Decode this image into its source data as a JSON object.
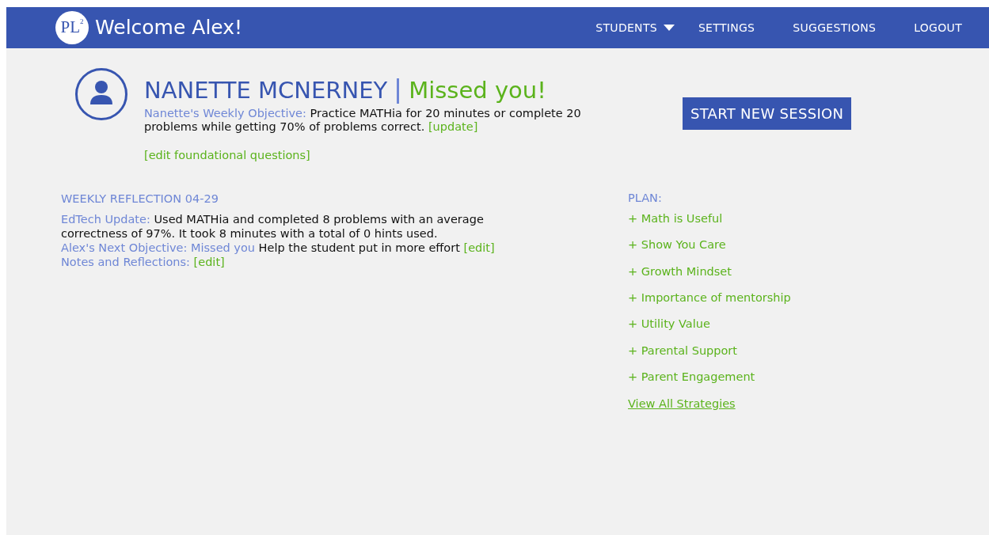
{
  "header": {
    "logo": "PL$^{2}$",
    "title": "Welcome Alex!"
  },
  "nav": [
    {
      "label": "STUDENTS",
      "kind": "dropdown"
    },
    {
      "label": "SETTINGS",
      "kind": "link"
    },
    {
      "label": "SUGGESTIONS",
      "kind": "link"
    },
    {
      "label": "LOGOUT",
      "kind": "link"
    }
  ],
  "student": {
    "name": "NANETTE MCNERNEY",
    "status": "Missed you!",
    "objective_label": "Nanette's Weekly Objective:",
    "objective_text": "Practice MATHia for 20 minutes or complete 20 problems while getting 70% of problems correct.",
    "objective_link": "[update]",
    "foundational_link": "[edit foundational questions]"
  },
  "start_button": "START NEW SESSION",
  "reflection": {
    "title": "WEEKLY REFLECTION 04-29",
    "lines": [
      {
        "label": "EdTech Update:",
        "text": "Used MATHia and completed 8 problems with an average correctness of 97%. It took 8 minutes with a total of 0 hints used."
      },
      {
        "label": "Alex's Next Objective: Missed you",
        "text": "Help the student put in more effort",
        "link": "[edit]"
      },
      {
        "label": "Notes and Reflections:",
        "link": "[edit]"
      }
    ]
  },
  "plan": {
    "title": "PLAN:",
    "items": [
      "+ Math is Useful",
      "+ Show You Care",
      "+ Growth Mindset",
      "+ Importance of mentorship",
      "+ Utility Value",
      "+ Parental Support",
      "+ Parent Engagement"
    ],
    "view_all": "View All Strategies"
  }
}
